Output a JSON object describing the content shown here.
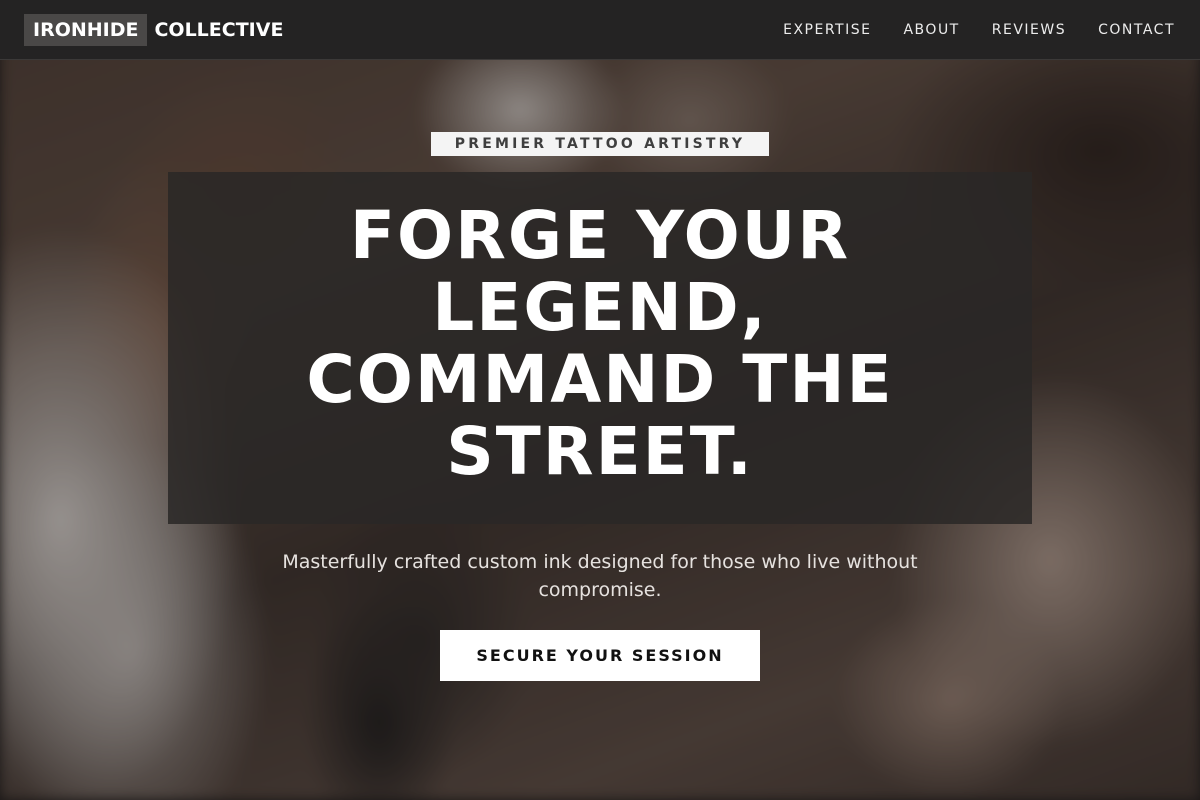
{
  "brand": {
    "highlight": "IRONHIDE",
    "rest": "COLLECTIVE"
  },
  "nav": {
    "items": [
      {
        "label": "EXPERTISE"
      },
      {
        "label": "ABOUT"
      },
      {
        "label": "REVIEWS"
      },
      {
        "label": "CONTACT"
      }
    ]
  },
  "hero": {
    "eyebrow": "PREMIER TATTOO ARTISTRY",
    "headline_lines": [
      "FORGE YOUR",
      "LEGEND,",
      "COMMAND THE",
      "STREET."
    ],
    "subtitle": "Masterfully crafted custom ink designed for those who live without compromise.",
    "cta_label": "SECURE YOUR SESSION"
  },
  "colors": {
    "navbar_bg": "#242323",
    "brand_box_bg": "#4a4847",
    "headline_panel_bg": "#2a2827",
    "cta_bg": "#ffffff",
    "cta_text": "#111111"
  }
}
